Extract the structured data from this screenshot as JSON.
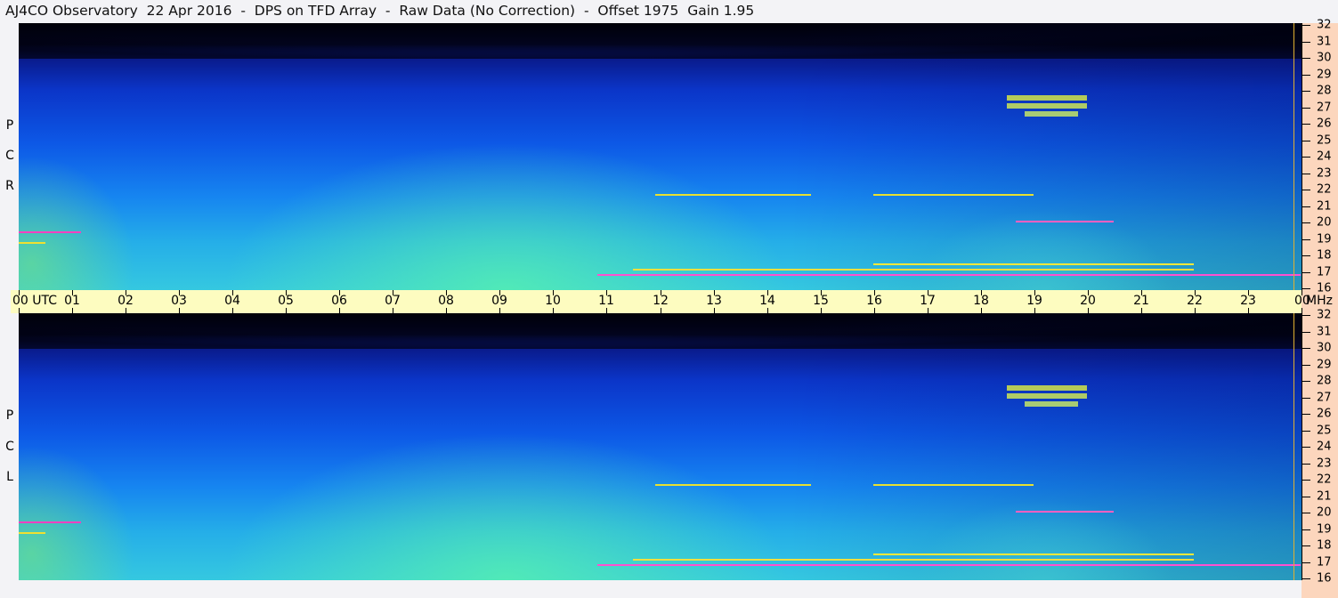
{
  "title": "AJ4CO Observatory  22 Apr 2016  -  DPS on TFD Array  -  Raw Data (No Correction)  -  Offset 1975  Gain 1.95",
  "panels": {
    "top": {
      "label": [
        "R",
        "C",
        "P"
      ]
    },
    "bottom": {
      "label": [
        "L",
        "C",
        "P"
      ]
    }
  },
  "time_axis": {
    "labels": [
      "00  UTC",
      "01",
      "02",
      "03",
      "04",
      "05",
      "06",
      "07",
      "08",
      "09",
      "10",
      "11",
      "12",
      "13",
      "14",
      "15",
      "16",
      "17",
      "18",
      "19",
      "20",
      "21",
      "22",
      "23",
      "00"
    ],
    "unit": "MHz"
  },
  "freq_axis": {
    "labels": [
      "16",
      "17",
      "18",
      "19",
      "20",
      "21",
      "22",
      "23",
      "24",
      "25",
      "26",
      "27",
      "28",
      "29",
      "30",
      "31",
      "32"
    ]
  },
  "colors": {
    "axis_band": "#fdfcc0",
    "right_axis": "#fcd6bd",
    "background": "#f3f3f6"
  }
}
